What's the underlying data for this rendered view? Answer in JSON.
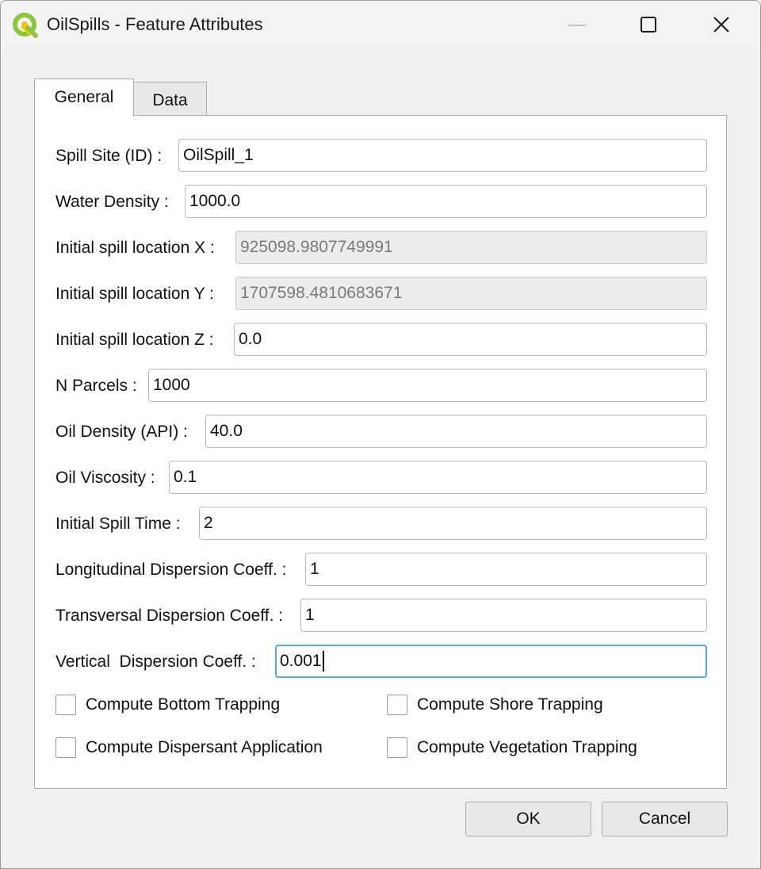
{
  "window": {
    "title": "OilSpills - Feature Attributes",
    "icons": {
      "app": "qgis-logo-icon",
      "minimize": "minimize-icon",
      "maximize": "maximize-icon",
      "close": "close-icon"
    }
  },
  "tabs": [
    {
      "label": "General",
      "selected": true
    },
    {
      "label": "Data",
      "selected": false
    }
  ],
  "fields": {
    "spill_site_id": {
      "label": "Spill Site (ID) :",
      "value": "OilSpill_1"
    },
    "water_density": {
      "label": "Water Density :",
      "value": "1000.0"
    },
    "initial_x": {
      "label": "Initial spill location X :",
      "value": "925098.9807749991",
      "enabled": false
    },
    "initial_y": {
      "label": "Initial spill location Y :",
      "value": "1707598.4810683671",
      "enabled": false
    },
    "initial_z": {
      "label": "Initial spill location Z :",
      "value": "0.0"
    },
    "n_parcels": {
      "label": "N Parcels :",
      "value": "1000"
    },
    "oil_density": {
      "label": "Oil Density (API) :",
      "value": "40.0"
    },
    "oil_viscosity": {
      "label": "Oil Viscosity :",
      "value": "0.1"
    },
    "initial_spill_time": {
      "label": "Initial Spill Time :",
      "value": "2"
    },
    "longitudinal_dispersion": {
      "label": "Longitudinal Dispersion Coeff. :",
      "value": "1"
    },
    "transversal_dispersion": {
      "label": "Transversal Dispersion Coeff. :",
      "value": "1"
    },
    "vertical_dispersion": {
      "label": "Vertical  Dispersion Coeff. :",
      "value": "0.001",
      "focused": true
    }
  },
  "checkboxes": {
    "bottom_trapping": {
      "label": "Compute Bottom Trapping",
      "checked": false
    },
    "shore_trapping": {
      "label": "Compute Shore Trapping",
      "checked": false
    },
    "dispersant_application": {
      "label": "Compute Dispersant Application",
      "checked": false
    },
    "vegetation_trapping": {
      "label": "Compute Vegetation Trapping",
      "checked": false
    }
  },
  "buttons": {
    "ok": "OK",
    "cancel": "Cancel"
  },
  "colors": {
    "focus_border": "#59a6e0",
    "qgis_green": "#8cc63f",
    "qgis_yellow": "#f3c400"
  }
}
